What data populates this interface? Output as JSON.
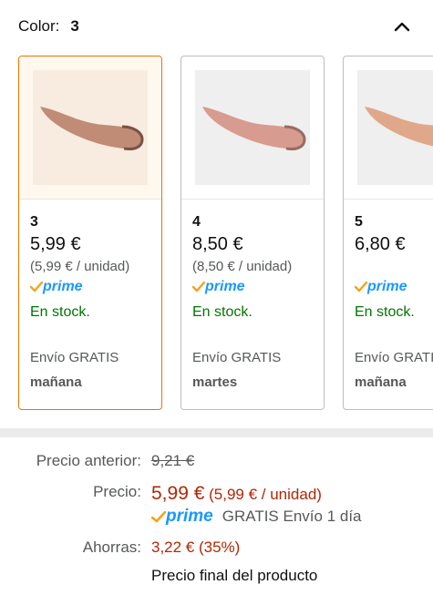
{
  "color_selector": {
    "label": "Color:",
    "selected_value": "3"
  },
  "swatches": [
    {
      "name": "3",
      "price": "5,99 €",
      "unit_price": "(5,99 € / unidad)",
      "prime": "prime",
      "stock": "En stock.",
      "shipping": "Envío GRATIS",
      "delivery_day": "mañana",
      "selected": true
    },
    {
      "name": "4",
      "price": "8,50 €",
      "unit_price": "(8,50 € / unidad)",
      "prime": "prime",
      "stock": "En stock.",
      "shipping": "Envío GRATIS",
      "delivery_day": "martes",
      "selected": false
    },
    {
      "name": "5",
      "price": "6,80 €",
      "unit_price": "",
      "prime": "prime",
      "stock": "En stock.",
      "shipping": "Envío GRATIS",
      "delivery_day": "mañana",
      "selected": false
    }
  ],
  "pricing": {
    "previous_label": "Precio anterior:",
    "previous_value": "9,21 €",
    "price_label": "Precio:",
    "price_value": "5,99 €",
    "price_unit": "(5,99 € / unidad)",
    "prime_label": "prime",
    "shipping_text": "GRATIS Envío 1 día",
    "savings_label": "Ahorras:",
    "savings_value": "3,22 € (35%)",
    "final_price_text": "Precio final del producto"
  },
  "colors": {
    "accent_orange": "#e77600",
    "price_red": "#b12704",
    "stock_green": "#007600",
    "prime_blue": "#1a98ff"
  }
}
